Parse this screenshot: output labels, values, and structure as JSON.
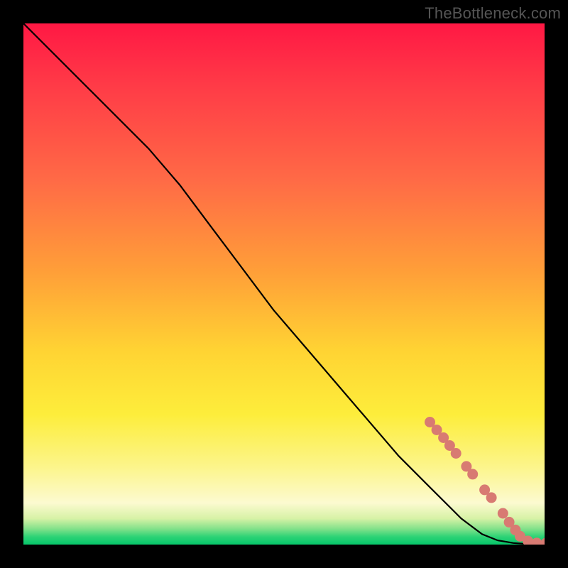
{
  "watermark": "TheBottleneck.com",
  "colors": {
    "marker": "#d87a72",
    "line": "#000000"
  },
  "chart_data": {
    "type": "line",
    "title": "",
    "xlabel": "",
    "ylabel": "",
    "xlim": [
      0,
      100
    ],
    "ylim": [
      0,
      100
    ],
    "series": [
      {
        "name": "curve",
        "x": [
          0,
          6,
          12,
          18,
          24,
          30,
          36,
          42,
          48,
          54,
          60,
          66,
          72,
          78,
          84,
          88,
          91,
          94,
          97,
          100
        ],
        "y": [
          100,
          94,
          88,
          82,
          76,
          69,
          61,
          53,
          45,
          38,
          31,
          24,
          17,
          11,
          5,
          2,
          0.8,
          0.3,
          0.1,
          0.1
        ]
      }
    ],
    "markers": [
      {
        "x": 78.0,
        "y": 23.5
      },
      {
        "x": 79.3,
        "y": 22.0
      },
      {
        "x": 80.6,
        "y": 20.5
      },
      {
        "x": 81.8,
        "y": 19.0
      },
      {
        "x": 83.0,
        "y": 17.5
      },
      {
        "x": 85.0,
        "y": 15.0
      },
      {
        "x": 86.2,
        "y": 13.5
      },
      {
        "x": 88.5,
        "y": 10.5
      },
      {
        "x": 89.8,
        "y": 9.0
      },
      {
        "x": 92.0,
        "y": 6.0
      },
      {
        "x": 93.2,
        "y": 4.3
      },
      {
        "x": 94.4,
        "y": 2.8
      },
      {
        "x": 95.3,
        "y": 1.6
      },
      {
        "x": 96.8,
        "y": 0.7
      },
      {
        "x": 98.5,
        "y": 0.3
      },
      {
        "x": 100.3,
        "y": 0.3
      }
    ]
  }
}
